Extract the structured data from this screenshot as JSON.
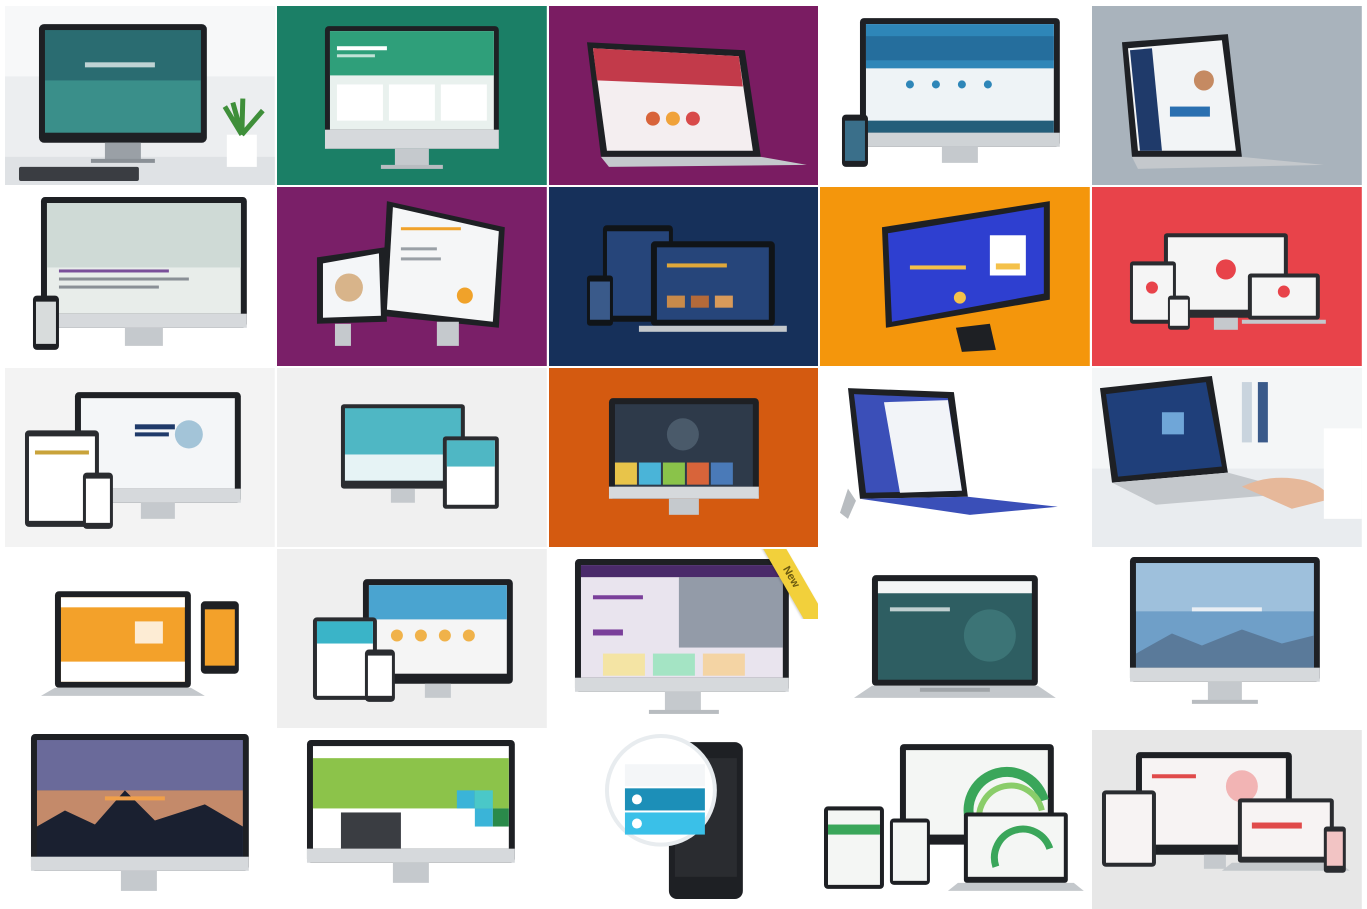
{
  "portfolio": {
    "badge_new": "New",
    "tiles": [
      {
        "bg": "#eceef0",
        "screen": "#3a8f8a",
        "accent": "#8fd3c7"
      },
      {
        "bg": "#1b7f66",
        "screen": "#e9f1ee",
        "accent": "#2f9f7a"
      },
      {
        "bg": "#7a1c62",
        "screen": "#f4eef0",
        "accent": "#d8633a"
      },
      {
        "bg": "#ffffff",
        "screen": "#eef3f6",
        "accent": "#2e86b8"
      },
      {
        "bg": "#a9b3bc",
        "screen": "#f2f4f6",
        "accent": "#2a6fb0"
      },
      {
        "bg": "#ffffff",
        "screen": "#e8edea",
        "accent": "#7a4f9a"
      },
      {
        "bg": "#7a1f68",
        "screen": "#f5f6f7",
        "accent": "#f0a22a"
      },
      {
        "bg": "#16305a",
        "screen": "#26457a",
        "accent": "#e0a83a"
      },
      {
        "bg": "#f4960c",
        "screen": "#2e3fd0",
        "accent": "#f4c14a"
      },
      {
        "bg": "#e8434a",
        "screen": "#f5f5f5",
        "accent": "#e8434a"
      },
      {
        "bg": "#f3f3f3",
        "screen": "#f4f6f8",
        "accent": "#c9a33a"
      },
      {
        "bg": "#f0f0f0",
        "screen": "#4fb7c4",
        "accent": "#e6f3f5"
      },
      {
        "bg": "#d45a10",
        "screen": "#2e3a4a",
        "accent": "#e8c44a"
      },
      {
        "bg": "#ffffff",
        "screen": "#3b4fb8",
        "accent": "#f2f4f8"
      },
      {
        "bg": "#e9ecef",
        "screen": "#1f3f7a",
        "accent": "#6fa6d8"
      },
      {
        "bg": "#ffffff",
        "screen": "#f3a12a",
        "accent": "#ffffff"
      },
      {
        "bg": "#efefef",
        "screen": "#f5f5f5",
        "accent": "#e2843a"
      },
      {
        "bg": "#ffffff",
        "screen": "#e9e4ee",
        "accent": "#7a3f9a"
      },
      {
        "bg": "#ffffff",
        "screen": "#2e5e62",
        "accent": "#4aa39a"
      },
      {
        "bg": "#ffffff",
        "screen": "#6f9fc8",
        "accent": "#e9eef4"
      },
      {
        "bg": "#ffffff",
        "screen": "#3a4670",
        "accent": "#f0a04a"
      },
      {
        "bg": "#ffffff",
        "screen": "#8cc34a",
        "accent": "#3ab4d8"
      },
      {
        "bg": "#ffffff",
        "screen": "#1c8fb8",
        "accent": "#3ac0e8"
      },
      {
        "bg": "#ffffff",
        "screen": "#f4f6f4",
        "accent": "#3aa65a"
      },
      {
        "bg": "#e7e7e7",
        "screen": "#f7f3f3",
        "accent": "#e04a4a"
      }
    ]
  }
}
